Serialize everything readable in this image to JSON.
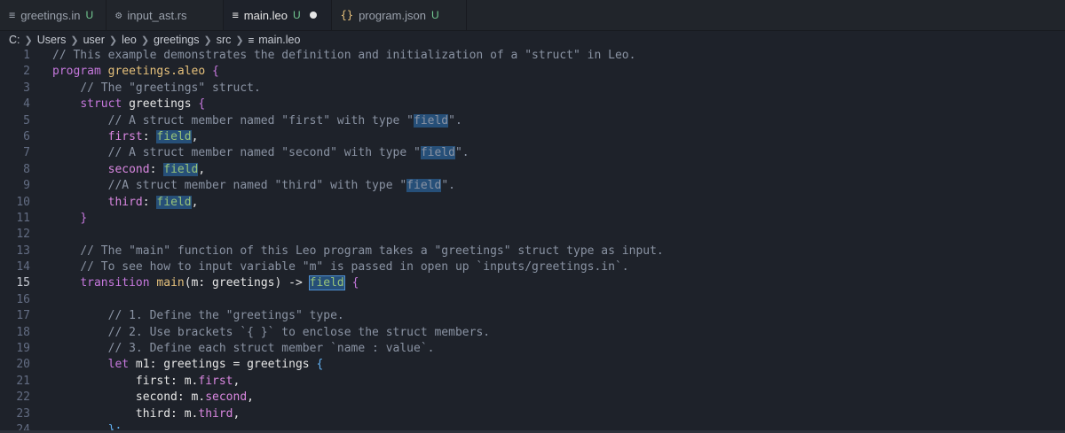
{
  "tabs": [
    {
      "icon": "≡",
      "label": "greetings.in",
      "status": "U"
    },
    {
      "icon": "⚙",
      "label": "input_ast.rs",
      "status": ""
    },
    {
      "icon": "≡",
      "label": "main.leo",
      "status": "U"
    },
    {
      "icon": "{}",
      "label": "program.json",
      "status": "U"
    }
  ],
  "breadcrumb": {
    "items": [
      "C:",
      "Users",
      "user",
      "leo",
      "greetings",
      "src"
    ],
    "file": "main.leo",
    "file_icon": "≡"
  },
  "code": {
    "lines": [
      "1",
      "2",
      "3",
      "4",
      "5",
      "6",
      "7",
      "8",
      "9",
      "10",
      "11",
      "12",
      "13",
      "14",
      "15",
      "16",
      "17",
      "18",
      "19",
      "20",
      "21",
      "22",
      "23",
      "24"
    ],
    "l1": "// This example demonstrates the definition and initialization of a \"struct\" in Leo.",
    "l2_kw": "program",
    "l2_name": "greetings.aleo",
    "l2_br": "{",
    "l3": "// The \"greetings\" struct.",
    "l4_kw": "struct",
    "l4_name": "greetings",
    "l4_br": "{",
    "l5_a": "// A struct member named \"first\" with type \"",
    "l5_b": "field",
    "l5_c": "\".",
    "l6_prop": "first",
    "l6_ty": "field",
    "l7_a": "// A struct member named \"second\" with type \"",
    "l7_b": "field",
    "l7_c": "\".",
    "l8_prop": "second",
    "l8_ty": "field",
    "l9_a": "//A struct member named \"third\" with type \"",
    "l9_b": "field",
    "l9_c": "\".",
    "l10_prop": "third",
    "l10_ty": "field",
    "l11_br": "}",
    "l13": "// The \"main\" function of this Leo program takes a \"greetings\" struct type as input.",
    "l14": "// To see how to input variable \"m\" is passed in open up `inputs/greetings.in`.",
    "l15_kw": "transition",
    "l15_name": "main",
    "l15_param": "(m: greetings) -> ",
    "l15_ty": "field",
    "l15_br": "{",
    "l17": "// 1. Define the \"greetings\" type.",
    "l18": "// 2. Use brackets `{ }` to enclose the struct members.",
    "l19": "// 3. Define each struct member `name : value`.",
    "l20_kw": "let",
    "l20_rest": " m1: greetings = greetings ",
    "l20_br": "{",
    "l21_a": "first: m.",
    "l21_b": "first",
    "l22_a": "second: m.",
    "l22_b": "second",
    "l23_a": "third: m.",
    "l23_b": "third",
    "l24": "};"
  }
}
